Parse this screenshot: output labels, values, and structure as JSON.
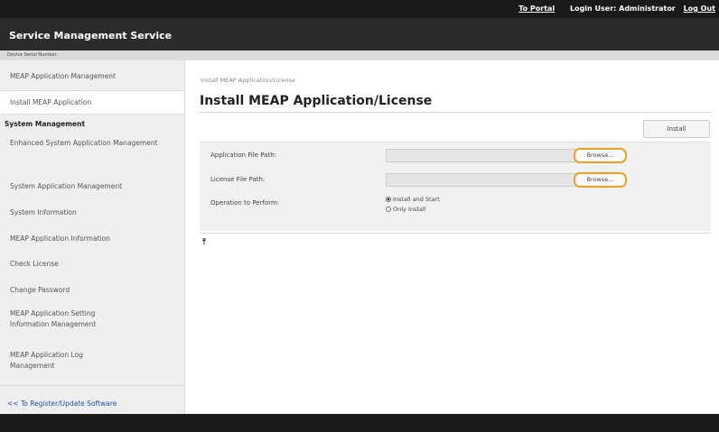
{
  "topbar": {
    "portal": "To Portal",
    "login_user": "Login User: Administrator",
    "logout": "Log Out"
  },
  "app_title": "Service Management Service",
  "serial_label": "Device Serial Number:",
  "sidebar": {
    "items": [
      {
        "label": "MEAP Application Management"
      },
      {
        "label": "Install MEAP Application"
      },
      {
        "label": "System Management"
      },
      {
        "label": "Enhanced System Application Management"
      },
      {
        "label": "System Application Management"
      },
      {
        "label": "System Information"
      },
      {
        "label": "MEAP Application Information"
      },
      {
        "label": "Check License"
      },
      {
        "label": "Change Password"
      },
      {
        "label": "MEAP Application Setting Information Management"
      },
      {
        "label": "MEAP Application Log Management"
      }
    ],
    "back_link": "<< To Register/Update Software"
  },
  "breadcrumb": "Install MEAP Application/License",
  "page_title": "Install MEAP Application/License",
  "install_button": "Install",
  "form": {
    "app_file_label": "Application File Path:",
    "license_file_label": "License File Path:",
    "browse_label": "Browse...",
    "operation_label": "Operation to Perform:",
    "options": [
      "Install and Start",
      "Only Install"
    ],
    "selected_option": "Install and Start"
  },
  "colors": {
    "header": "#1a1a1a",
    "title_bar": "#2b2b2b",
    "sidebar_bg": "#efefef",
    "highlight": "#f0a01e",
    "link": "#1f4fa0"
  },
  "icons": {
    "page_top": "arrow-to-top-icon"
  }
}
